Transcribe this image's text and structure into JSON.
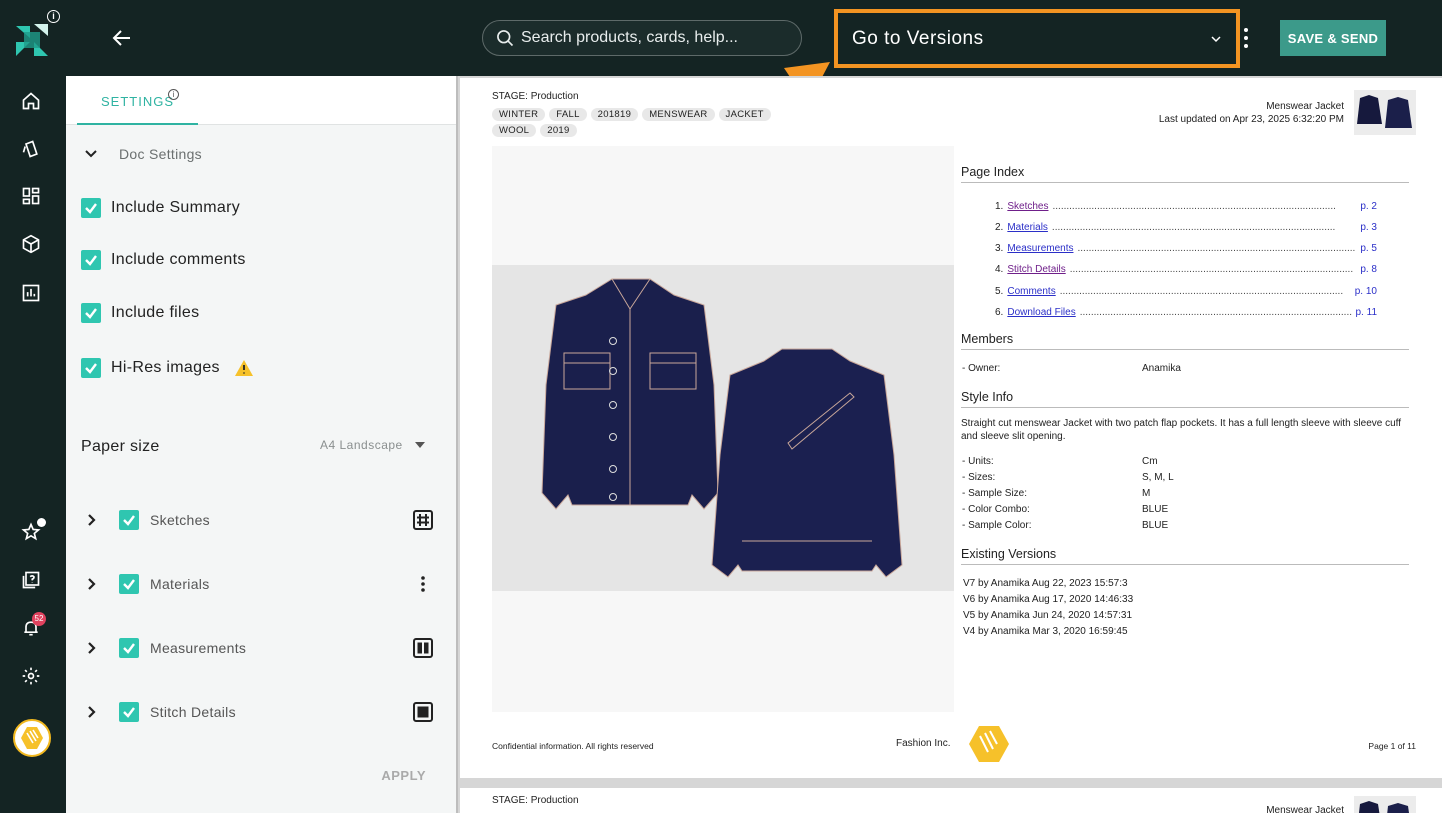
{
  "header": {
    "search_placeholder": "Search products, cards, help...",
    "versions_dropdown": "Go to Versions",
    "save_send": "SAVE & SEND"
  },
  "rail": {
    "notification_count": "52"
  },
  "settings": {
    "tab_label": "SETTINGS",
    "doc_settings": "Doc Settings",
    "options": [
      {
        "label": "Include Summary",
        "checked": true
      },
      {
        "label": "Include comments",
        "checked": true
      },
      {
        "label": "Include files",
        "checked": true
      },
      {
        "label": "Hi-Res images",
        "checked": true
      }
    ],
    "paper_size_label": "Paper size",
    "paper_size_value": "A4 Landscape",
    "sections": [
      {
        "label": "Sketches",
        "checked": true,
        "action_icon": "grid-layout-icon"
      },
      {
        "label": "Materials",
        "checked": true,
        "action_icon": "more-vert-icon"
      },
      {
        "label": "Measurements",
        "checked": true,
        "action_icon": "two-column-layout-icon"
      },
      {
        "label": "Stitch Details",
        "checked": true,
        "action_icon": "single-layout-icon"
      }
    ],
    "apply": "APPLY"
  },
  "doc": {
    "stage": "STAGE: Production",
    "tags": [
      "WINTER",
      "FALL",
      "201819",
      "MENSWEAR",
      "JACKET",
      "WOOL",
      "2019"
    ],
    "product_name": "Menswear Jacket",
    "last_updated": "Last updated on Apr 23, 2025 6:32:20 PM",
    "page_index_title": "Page Index",
    "index": [
      {
        "num": "1.",
        "name": "Sketches",
        "page": "p. 2",
        "visited": true
      },
      {
        "num": "2.",
        "name": "Materials",
        "page": "p. 3",
        "visited": false
      },
      {
        "num": "3.",
        "name": "Measurements",
        "page": "p. 5",
        "visited": false
      },
      {
        "num": "4.",
        "name": "Stitch Details",
        "page": "p. 8",
        "visited": true
      },
      {
        "num": "5.",
        "name": "Comments",
        "page": "p. 10",
        "visited": false
      },
      {
        "num": "6.",
        "name": "Download Files",
        "page": "p. 11",
        "visited": false
      }
    ],
    "members_title": "Members",
    "owner_label": "- Owner:",
    "owner_value": "Anamika",
    "style_info_title": "Style Info",
    "style_desc": "Straight cut menswear Jacket with two patch flap pockets. It has a full length sleeve with sleeve cuff and sleeve slit opening.",
    "style_info": [
      {
        "k": "- Units:",
        "v": "Cm"
      },
      {
        "k": "- Sizes:",
        "v": "S, M, L"
      },
      {
        "k": "- Sample Size:",
        "v": "M"
      },
      {
        "k": "- Color Combo:",
        "v": "BLUE"
      },
      {
        "k": "- Sample Color:",
        "v": "BLUE"
      }
    ],
    "versions_title": "Existing Versions",
    "versions": [
      "V7 by Anamika Aug 22, 2023 15:57:3",
      "V6 by Anamika Aug 17, 2020 14:46:33",
      "V5 by Anamika Jun 24, 2020 14:57:31",
      "V4 by Anamika Mar 3, 2020 16:59:45"
    ],
    "footer_left": "Confidential information. All rights reserved",
    "footer_company": "Fashion Inc.",
    "footer_page": "Page 1 of 11",
    "page2_stage": "STAGE: Production",
    "page2_product": "Menswear Jacket"
  },
  "colors": {
    "sidebar_bg": "#142423",
    "accent": "#2fc6b0",
    "highlight": "#f39422",
    "save_button": "#3c9a8a"
  }
}
